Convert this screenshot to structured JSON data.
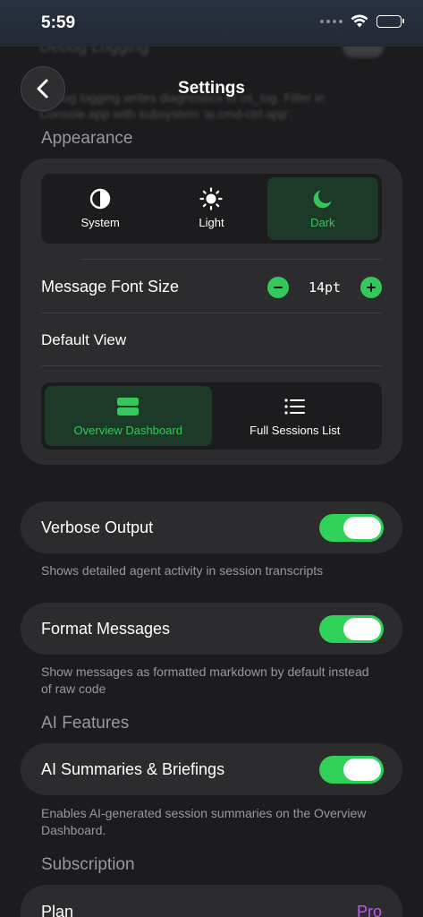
{
  "status": {
    "time": "5:59"
  },
  "background": {
    "title": "Debug Logging",
    "text": "Debug logging writes diagnostics to os_log. Filter in Console.app with subsystem 'ai.cmd-ctrl.app'."
  },
  "nav": {
    "title": "Settings",
    "back_icon": "chevron-left-icon"
  },
  "appearance": {
    "header": "Appearance",
    "theme_options": [
      {
        "label": "System",
        "icon": "half-circle-icon",
        "selected": false
      },
      {
        "label": "Light",
        "icon": "sun-icon",
        "selected": false
      },
      {
        "label": "Dark",
        "icon": "moon-icon",
        "selected": true
      }
    ],
    "font_size": {
      "label": "Message Font Size",
      "value": "14pt"
    },
    "default_view": {
      "label": "Default View",
      "options": [
        {
          "label": "Overview Dashboard",
          "icon": "dashboard-icon",
          "selected": true
        },
        {
          "label": "Full Sessions List",
          "icon": "list-icon",
          "selected": false
        }
      ]
    }
  },
  "verbose": {
    "label": "Verbose Output",
    "enabled": true,
    "footnote": "Shows detailed agent activity in session transcripts"
  },
  "format": {
    "label": "Format Messages",
    "enabled": true,
    "footnote": "Show messages as formatted markdown by default instead of raw code"
  },
  "ai": {
    "header": "AI Features",
    "label": "AI Summaries & Briefings",
    "enabled": true,
    "footnote": "Enables AI-generated session summaries on the Overview Dashboard."
  },
  "subscription": {
    "header": "Subscription",
    "plan_label": "Plan",
    "plan_value": "Pro"
  },
  "colors": {
    "accent": "#34c759",
    "pro": "#bf5af2",
    "card": "#2c2c2e",
    "background": "#1c1c1e"
  }
}
